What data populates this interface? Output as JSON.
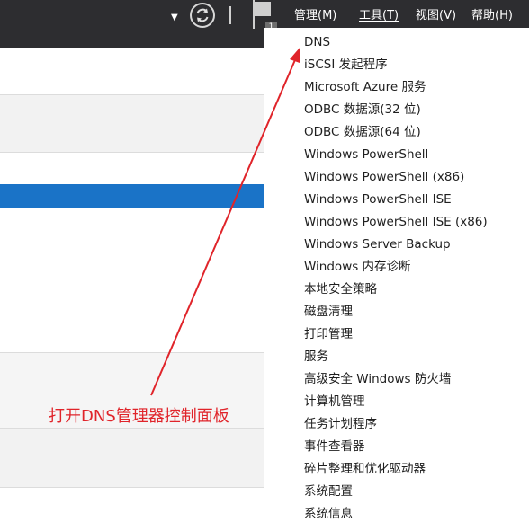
{
  "menubar": {
    "manage": "管理(M)",
    "tools": "工具(T)",
    "view": "视图(V)",
    "help": "帮助(H)"
  },
  "notification_count": "1",
  "tools_menu": {
    "items": [
      "DNS",
      "iSCSI 发起程序",
      "Microsoft Azure 服务",
      "ODBC 数据源(32 位)",
      "ODBC 数据源(64 位)",
      "Windows PowerShell",
      "Windows PowerShell (x86)",
      "Windows PowerShell ISE",
      "Windows PowerShell ISE (x86)",
      "Windows Server Backup",
      "Windows 内存诊断",
      "本地安全策略",
      "磁盘清理",
      "打印管理",
      "服务",
      "高级安全 Windows 防火墙",
      "计算机管理",
      "任务计划程序",
      "事件查看器",
      "碎片整理和优化驱动器",
      "系统配置",
      "系统信息"
    ]
  },
  "annotation": {
    "text": "打开DNS管理器控制面板",
    "color": "#e0242a"
  },
  "colors": {
    "topbar": "#2d2d30",
    "selection": "#1a73c7"
  }
}
